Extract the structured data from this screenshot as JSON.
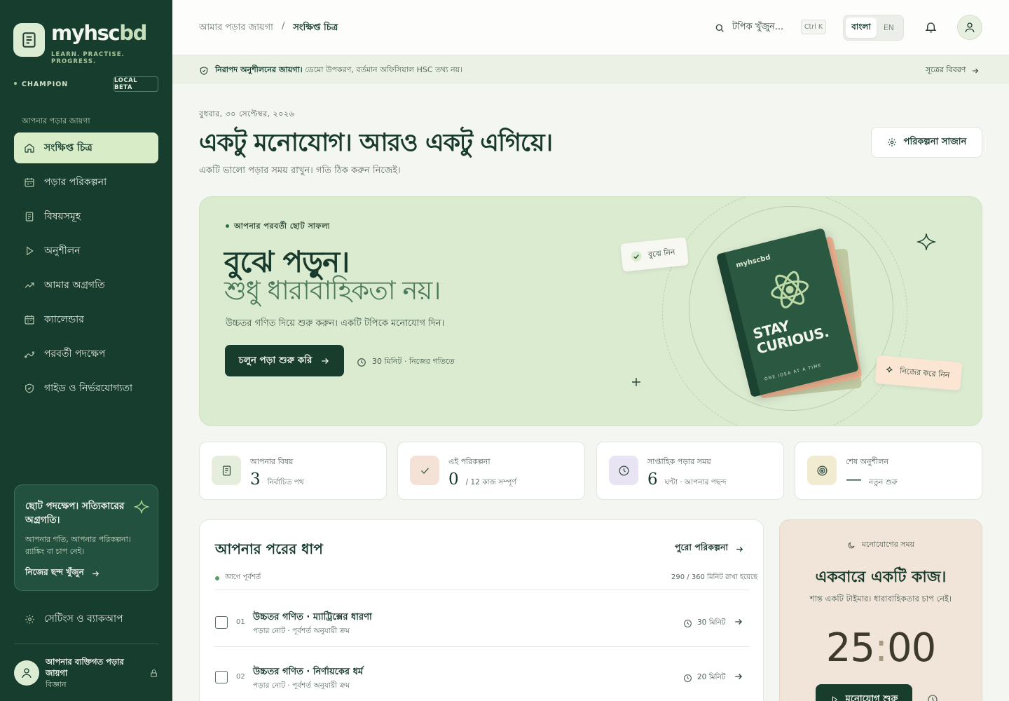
{
  "brand": {
    "name_a": "myhsc",
    "name_b": "bd",
    "tagline": "LEARN. PRACTISE. PROGRESS.",
    "tier": "CHAMPION",
    "badge": "LOCAL BETA"
  },
  "sidebar": {
    "heading": "আপনার পড়ার জায়গা",
    "items": [
      {
        "label": "সংক্ষিপ্ত চিত্র",
        "icon": "home-icon",
        "active": true
      },
      {
        "label": "পড়ার পরিকল্পনা",
        "icon": "calendar-icon"
      },
      {
        "label": "বিষয়সমূহ",
        "icon": "document-icon"
      },
      {
        "label": "অনুশীলন",
        "icon": "play-icon"
      },
      {
        "label": "আমার অগ্রগতি",
        "icon": "trend-icon"
      },
      {
        "label": "ক্যালেন্ডার",
        "icon": "calendar-icon"
      },
      {
        "label": "পরবর্তী পদক্ষেপ",
        "icon": "path-icon"
      },
      {
        "label": "গাইড ও নির্ভরযোগ্যতা",
        "icon": "shield-icon"
      }
    ],
    "promo": {
      "title": "ছোট পদক্ষেপ। সত্যিকারের অগ্রগতি।",
      "text": "আপনার গতি, আপনার পরিকল্পনা। র‍্যাঙ্কিং বা চাপ নেই।",
      "link": "নিজের ছন্দ খুঁজুন"
    },
    "settings": "সেটিংস ও ব্যাকআপ",
    "user": {
      "name": "আপনার ব্যক্তিগত পড়ার জায়গা",
      "group": "বিজ্ঞান"
    }
  },
  "topbar": {
    "breadcrumb_root": "আমার পড়ার জায়গা",
    "breadcrumb_sep": "/",
    "breadcrumb_current": "সংক্ষিপ্ত চিত্র",
    "search_placeholder": "টপিক খুঁজুন...",
    "shortcut": "Ctrl K",
    "lang_active": "বাংলা",
    "lang_other": "EN"
  },
  "notice": {
    "bold": "নিরাপদ অনুশীলনের জায়গা।",
    "text": "ডেমো উপকরণ, বর্তমান অফিসিয়াল HSC তথ্য নয়।",
    "link": "সূত্রের বিবরণ"
  },
  "header": {
    "date": "বুধবার, ৩০ সেপ্টেম্বর, ২০২৬",
    "title": "একটু মনোযোগ। আরও একটু এগিয়ে।",
    "subtitle": "একটি ভালো পড়ার সময় রাখুন। গতি ঠিক করুন নিজেই।",
    "plan_button": "পরিকল্পনা সাজান"
  },
  "hero": {
    "eyebrow": "আপনার পরবর্তী ছোট সাফল্য",
    "title1": "বুঝে পড়ুন।",
    "title2": "শুধু ধারাবাহিকতা নয়।",
    "desc": "উচ্চতর গণিত দিয়ে শুরু করুন। একটি টপিকে মনোযোগ দিন।",
    "button": "চলুন পড়া শুরু করি",
    "time": "30 মিনিট · নিজের গতিতে",
    "chip1": "বুঝে নিন",
    "chip2": "নিজের করে নিন",
    "book": {
      "brand": "myhscbd",
      "title1": "STAY",
      "title2": "CURIOUS.",
      "foot": "ONE IDEA AT A TIME"
    }
  },
  "stats": [
    {
      "label": "আপনার বিষয়",
      "value": "3",
      "note": "নির্বাচিত পথ",
      "icon": "document-icon",
      "color": "#e5eddc"
    },
    {
      "label": "এই পরিকল্পনা",
      "value": "0",
      "note": "/ 12 কাজ সম্পূর্ণ",
      "icon": "check-icon",
      "color": "#f5e2d6"
    },
    {
      "label": "সাপ্তাহিক পড়ার সময়",
      "value": "6",
      "note": "ঘণ্টা · আপনার পছন্দ",
      "icon": "clock-icon",
      "color": "#e8e4f3"
    },
    {
      "label": "শেষ অনুশীলন",
      "value": "—",
      "note": "নতুন শুরু",
      "icon": "target-icon",
      "color": "#f1ebd2"
    }
  ],
  "steps": {
    "title": "আপনার পরের ধাপ",
    "link": "পুরো পরিকল্পনা",
    "pre": "আগে পূর্বশর্ত",
    "progress": "290 / 360 মিনিট রাখা হয়েছে",
    "tasks": [
      {
        "num": "01",
        "title": "উচ্চতর গণিত · ম্যাট্রিক্সের ধারণা",
        "sub": "পড়ার নোট · পূর্বশর্ত অনুযায়ী ক্রম",
        "time": "30 মিনিট"
      },
      {
        "num": "02",
        "title": "উচ্চতর গণিত · নির্ণায়কের ধর্ম",
        "sub": "পড়ার নোট · পূর্বশর্ত অনুযায়ী ক্রম",
        "time": "20 মিনিট"
      }
    ]
  },
  "focus": {
    "eyebrow": "মনোযোগের সময়",
    "title": "একবারে একটি কাজ।",
    "subtitle": "শান্ত একটি টাইমার। ধারাবাহিকতার চাপ নেই।",
    "minutes": "25",
    "sep": ":",
    "seconds": "00",
    "button": "মনোযোগ শুরু"
  }
}
